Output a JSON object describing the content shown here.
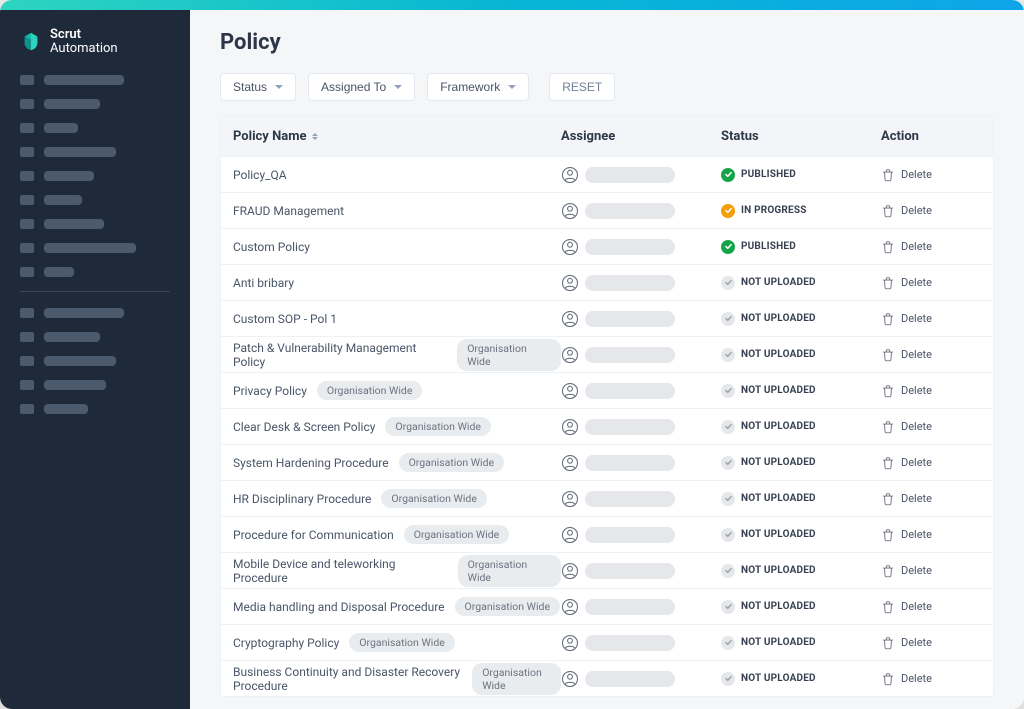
{
  "brand": {
    "line1": "Scrut",
    "line2": "Automation"
  },
  "sidebar": {
    "section1": [
      80,
      56,
      34,
      72,
      50,
      38,
      60,
      92,
      30
    ],
    "section2": [
      80,
      56,
      72,
      62,
      44
    ]
  },
  "page": {
    "title": "Policy"
  },
  "filters": {
    "status": "Status",
    "assigned": "Assigned To",
    "framework": "Framework",
    "reset": "RESET"
  },
  "columns": {
    "name": "Policy Name",
    "assignee": "Assignee",
    "status": "Status",
    "action": "Action"
  },
  "tag_label": "Organisation Wide",
  "action_label": "Delete",
  "status_labels": {
    "published": "PUBLISHED",
    "in_progress": "IN PROGRESS",
    "not_uploaded": "NOT UPLOADED"
  },
  "rows": [
    {
      "name": "Policy_QA",
      "tag": false,
      "status": "published"
    },
    {
      "name": "FRAUD Management",
      "tag": false,
      "status": "in_progress"
    },
    {
      "name": "Custom Policy",
      "tag": false,
      "status": "published"
    },
    {
      "name": "Anti bribary",
      "tag": false,
      "status": "not_uploaded"
    },
    {
      "name": "Custom SOP - Pol 1",
      "tag": false,
      "status": "not_uploaded"
    },
    {
      "name": "Patch & Vulnerability Management Policy",
      "tag": true,
      "status": "not_uploaded"
    },
    {
      "name": "Privacy Policy",
      "tag": true,
      "status": "not_uploaded"
    },
    {
      "name": "Clear Desk & Screen Policy",
      "tag": true,
      "status": "not_uploaded"
    },
    {
      "name": "System Hardening Procedure",
      "tag": true,
      "status": "not_uploaded"
    },
    {
      "name": "HR Disciplinary Procedure",
      "tag": true,
      "status": "not_uploaded"
    },
    {
      "name": "Procedure for Communication",
      "tag": true,
      "status": "not_uploaded"
    },
    {
      "name": "Mobile Device and teleworking Procedure",
      "tag": true,
      "status": "not_uploaded"
    },
    {
      "name": "Media handling and Disposal Procedure",
      "tag": true,
      "status": "not_uploaded"
    },
    {
      "name": "Cryptography Policy",
      "tag": true,
      "status": "not_uploaded"
    },
    {
      "name": "Business Continuity and Disaster Recovery Procedure",
      "tag": true,
      "status": "not_uploaded"
    }
  ]
}
